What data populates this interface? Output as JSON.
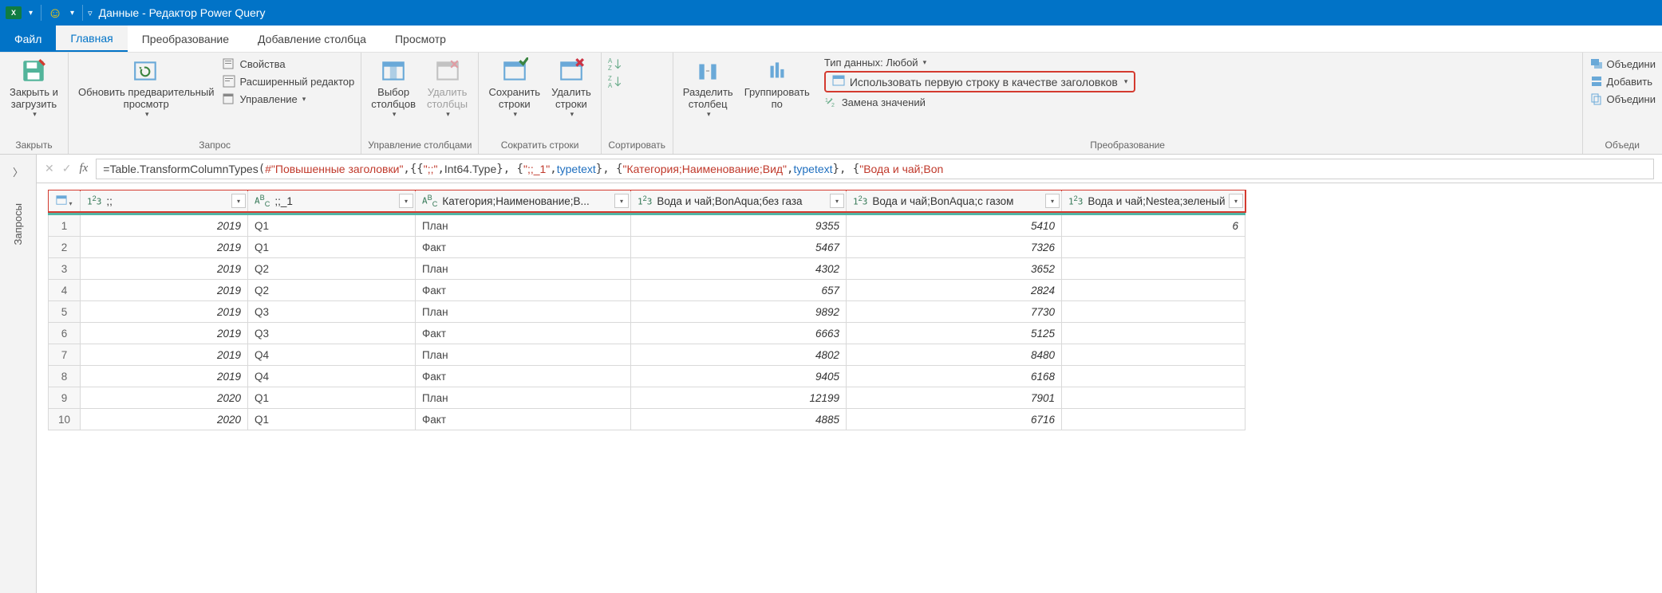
{
  "titlebar": {
    "title": "Данные - Редактор Power Query"
  },
  "tabs": {
    "file": "Файл",
    "items": [
      "Главная",
      "Преобразование",
      "Добавление столбца",
      "Просмотр"
    ],
    "active": 0
  },
  "ribbon": {
    "groups": {
      "close": {
        "label": "Закрыть",
        "close_load": "Закрыть и\nзагрузить"
      },
      "query": {
        "label": "Запрос",
        "refresh": "Обновить предварительный\nпросмотр",
        "properties": "Свойства",
        "advanced": "Расширенный редактор",
        "manage": "Управление"
      },
      "columns": {
        "label": "Управление столбцами",
        "choose": "Выбор\nстолбцов",
        "remove": "Удалить\nстолбцы"
      },
      "rows": {
        "label": "Сократить строки",
        "keep": "Сохранить\nстроки",
        "delete": "Удалить\nстроки"
      },
      "sort": {
        "label": "Сортировать"
      },
      "split_group": {
        "split": "Разделить\nстолбец",
        "group": "Группировать\nпо"
      },
      "transform": {
        "label": "Преобразование",
        "datatype": "Тип данных: Любой",
        "first_row_headers": "Использовать первую строку в качестве заголовков",
        "replace": "Замена значений"
      },
      "combine": {
        "label": "Объеди",
        "merge": "Объедини",
        "append": "Добавить",
        "combine_files": "Объедини"
      }
    }
  },
  "queries_pane": {
    "label": "Запросы"
  },
  "formula": {
    "prefix": "= ",
    "fn": "Table.TransformColumnTypes",
    "arg0": "#\"Повышенные заголовки\"",
    "p1": "\";;\"",
    "t1": "Int64.Type",
    "p2": "\";;_1\"",
    "t2a": "type",
    "t2b": "text",
    "p3": "\"Категория;Наименование;Вид\"",
    "t3a": "type",
    "t3b": "text",
    "p4": "\"Вода и чай;Bon"
  },
  "grid": {
    "columns": [
      {
        "type": "num",
        "label": ";;"
      },
      {
        "type": "txt",
        "label": ";;_1"
      },
      {
        "type": "txt",
        "label": "Категория;Наименование;В..."
      },
      {
        "type": "num",
        "label": "Вода и чай;BonAqua;без газа"
      },
      {
        "type": "num",
        "label": "Вода и чай;BonAqua;с газом"
      },
      {
        "type": "num",
        "label": "Вода и чай;Nestea;зеленый"
      }
    ],
    "rows": [
      {
        "n": 1,
        "c0": "2019",
        "c1": "Q1",
        "c2": "План",
        "c3": "9355",
        "c4": "5410",
        "c5": "6"
      },
      {
        "n": 2,
        "c0": "2019",
        "c1": "Q1",
        "c2": "Факт",
        "c3": "5467",
        "c4": "7326",
        "c5": ""
      },
      {
        "n": 3,
        "c0": "2019",
        "c1": "Q2",
        "c2": "План",
        "c3": "4302",
        "c4": "3652",
        "c5": ""
      },
      {
        "n": 4,
        "c0": "2019",
        "c1": "Q2",
        "c2": "Факт",
        "c3": "657",
        "c4": "2824",
        "c5": ""
      },
      {
        "n": 5,
        "c0": "2019",
        "c1": "Q3",
        "c2": "План",
        "c3": "9892",
        "c4": "7730",
        "c5": ""
      },
      {
        "n": 6,
        "c0": "2019",
        "c1": "Q3",
        "c2": "Факт",
        "c3": "6663",
        "c4": "5125",
        "c5": ""
      },
      {
        "n": 7,
        "c0": "2019",
        "c1": "Q4",
        "c2": "План",
        "c3": "4802",
        "c4": "8480",
        "c5": ""
      },
      {
        "n": 8,
        "c0": "2019",
        "c1": "Q4",
        "c2": "Факт",
        "c3": "9405",
        "c4": "6168",
        "c5": ""
      },
      {
        "n": 9,
        "c0": "2020",
        "c1": "Q1",
        "c2": "План",
        "c3": "12199",
        "c4": "7901",
        "c5": ""
      },
      {
        "n": 10,
        "c0": "2020",
        "c1": "Q1",
        "c2": "Факт",
        "c3": "4885",
        "c4": "6716",
        "c5": ""
      }
    ]
  }
}
